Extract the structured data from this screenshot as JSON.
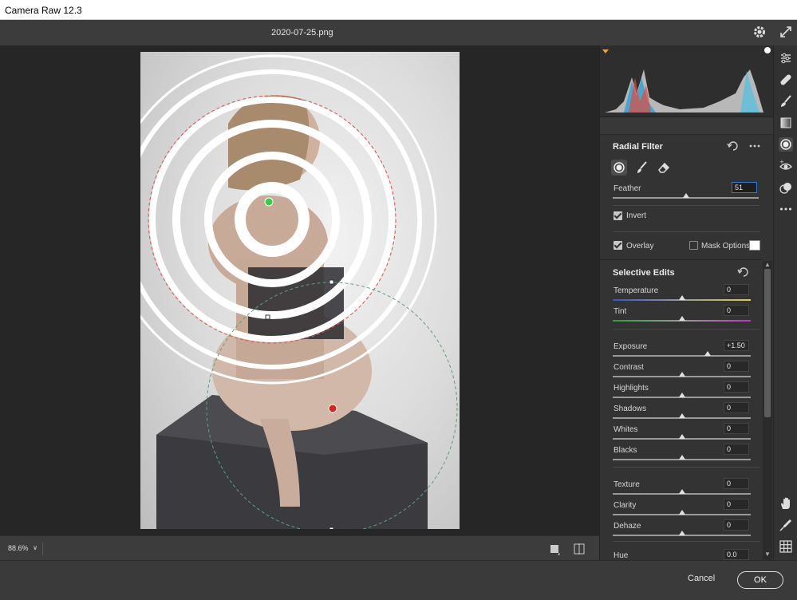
{
  "window": {
    "title": "Camera Raw 12.3"
  },
  "header": {
    "filename": "2020-07-25.png"
  },
  "zoom": {
    "level": "88.6%"
  },
  "radial_filter": {
    "title": "Radial Filter",
    "feather_label": "Feather",
    "feather_value": "51",
    "invert_label": "Invert",
    "invert_checked": true,
    "overlay_label": "Overlay",
    "overlay_checked": true,
    "mask_options_label": "Mask Options",
    "mask_options_checked": false,
    "mask_color": "#ffffff"
  },
  "selective_edits": {
    "title": "Selective Edits",
    "sliders": [
      {
        "label": "Temperature",
        "value": "0",
        "position": 0.5
      },
      {
        "label": "Tint",
        "value": "0",
        "position": 0.5
      },
      {
        "label": "Exposure",
        "value": "+1.50",
        "position": 0.6875
      },
      {
        "label": "Contrast",
        "value": "0",
        "position": 0.5
      },
      {
        "label": "Highlights",
        "value": "0",
        "position": 0.5
      },
      {
        "label": "Shadows",
        "value": "0",
        "position": 0.5
      },
      {
        "label": "Whites",
        "value": "0",
        "position": 0.5
      },
      {
        "label": "Blacks",
        "value": "0",
        "position": 0.5
      },
      {
        "label": "Texture",
        "value": "0",
        "position": 0.5
      },
      {
        "label": "Clarity",
        "value": "0",
        "position": 0.5
      },
      {
        "label": "Dehaze",
        "value": "0",
        "position": 0.5
      },
      {
        "label": "Hue",
        "value": "0.0",
        "position": 0.5
      }
    ],
    "feather_position": 0.5
  },
  "footer": {
    "cancel_label": "Cancel",
    "ok_label": "OK"
  },
  "icons": {
    "header": [
      "gear-icon",
      "expand-icon"
    ],
    "filter_tools": [
      "radial-mask-icon",
      "brush-icon",
      "eraser-icon"
    ],
    "toolbar": [
      "edit-sliders-icon",
      "healing-icon",
      "brush-icon",
      "graduated-filter-icon",
      "radial-filter-icon",
      "red-eye-icon",
      "presets-icon",
      "more-icon",
      "hand-icon",
      "sampler-icon",
      "grid-icon"
    ]
  },
  "colors": {
    "accent": "#2d7ad6",
    "green_pin": "#34d04a",
    "red_pin": "#e0201f"
  }
}
